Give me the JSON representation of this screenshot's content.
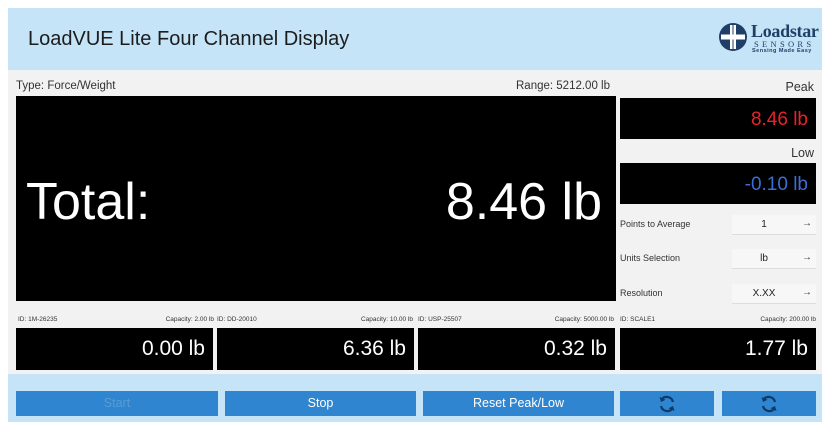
{
  "app": {
    "title": "LoadVUE Lite Four Channel Display",
    "logo": {
      "word": "Loadstar",
      "sub": "SENSORS",
      "tag": "Sensing Made Easy"
    }
  },
  "main": {
    "type_label": "Type: Force/Weight",
    "range_label": "Range: 5212.00 lb",
    "total_label": "Total:",
    "total_value": "8.46 lb"
  },
  "peak": {
    "label": "Peak",
    "value": "8.46 lb",
    "color": "#e8232a"
  },
  "low": {
    "label": "Low",
    "value": "-0.10 lb",
    "color": "#3d6ed6"
  },
  "settings": {
    "points_label": "Points to Average",
    "points_value": "1",
    "units_label": "Units Selection",
    "units_value": "lb",
    "resolution_label": "Resolution",
    "resolution_value": "X.XX"
  },
  "channels": [
    {
      "id": "ID: 1M-26235",
      "capacity": "Capacity: 2.00 lb",
      "value": "0.00 lb"
    },
    {
      "id": "ID: DD-20010",
      "capacity": "Capacity: 10.00 lb",
      "value": "6.36 lb"
    },
    {
      "id": "ID: USP-25507",
      "capacity": "Capacity: 5000.00 lb",
      "value": "0.32 lb"
    },
    {
      "id": "ID: SCALE1",
      "capacity": "Capacity: 200.00 lb",
      "value": "1.77 lb"
    }
  ],
  "buttons": {
    "start_label": "Start",
    "stop_label": "Stop",
    "reset_label": "Reset Peak/Low",
    "refresh_icon": "refresh-icon",
    "settings_icon": "refresh-icon"
  },
  "colors": {
    "header_bg": "#c5e4f7",
    "button_bg": "#2f85cf",
    "display_bg": "#000000"
  }
}
